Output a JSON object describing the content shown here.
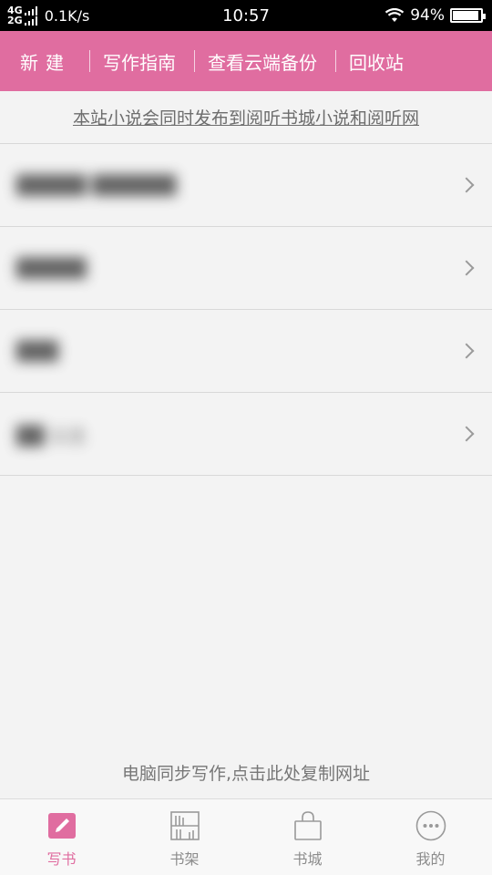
{
  "status_bar": {
    "network_top": "4G",
    "network_bottom": "2G",
    "speed": "0.1K/s",
    "time": "10:57",
    "battery": "94%",
    "battery_level": 0.94,
    "wifi_icon": "wifi-icon"
  },
  "toolbar": {
    "items": [
      "新建",
      "写作指南",
      "查看云端备份",
      "回收站"
    ]
  },
  "notice": "本站小说会同时发布到阅听书城小说和阅听网",
  "list": {
    "items": [
      {
        "title": "█████ ██████"
      },
      {
        "title": "█████"
      },
      {
        "title": "███"
      },
      {
        "title": "██ 公主"
      }
    ]
  },
  "sync_link": "电脑同步写作,点击此处复制网址",
  "bottom_nav": {
    "items": [
      {
        "label": "写书",
        "icon": "edit-icon",
        "active": true
      },
      {
        "label": "书架",
        "icon": "bookshelf-icon",
        "active": false
      },
      {
        "label": "书城",
        "icon": "shopping-bag-icon",
        "active": false
      },
      {
        "label": "我的",
        "icon": "more-icon",
        "active": false
      }
    ]
  },
  "colors": {
    "accent": "#e06da0",
    "background": "#f3f3f3"
  }
}
